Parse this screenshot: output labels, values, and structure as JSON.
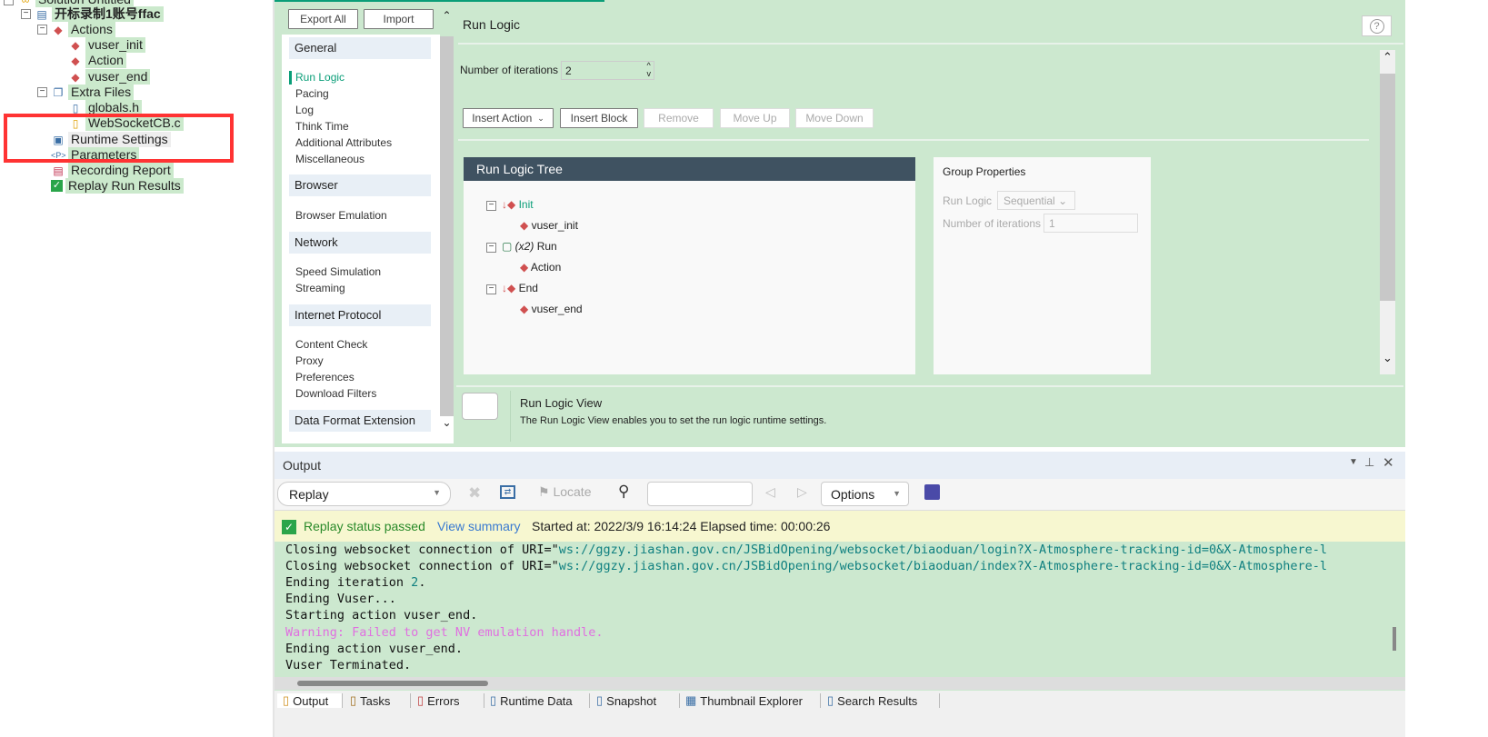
{
  "tree": {
    "solution": "Solution Untitled",
    "script": "开标录制1账号ffac",
    "actions": "Actions",
    "vuser_init": "vuser_init",
    "action": "Action",
    "vuser_end": "vuser_end",
    "extra_files": "Extra Files",
    "globals": "globals.h",
    "websocket": "WebSocketCB.c",
    "runtime_settings": "Runtime Settings",
    "parameters": "Parameters",
    "recording_report": "Recording Report",
    "replay_results": "Replay Run Results"
  },
  "nav": {
    "export_all": "Export All",
    "import": "Import",
    "sections": [
      {
        "title": "General",
        "items": [
          "Run Logic",
          "Pacing",
          "Log",
          "Think Time",
          "Additional Attributes",
          "Miscellaneous"
        ]
      },
      {
        "title": "Browser",
        "items": [
          "Browser Emulation"
        ]
      },
      {
        "title": "Network",
        "items": [
          "Speed Simulation",
          "Streaming"
        ]
      },
      {
        "title": "Internet Protocol",
        "items": [
          "Content Check",
          "Proxy",
          "Preferences",
          "Download Filters"
        ]
      },
      {
        "title": "Data Format Extension",
        "items": []
      }
    ],
    "active": "Run Logic"
  },
  "content": {
    "title": "Run Logic",
    "help": "?",
    "iterations_label": "Number of iterations",
    "iterations_value": "2",
    "insert_action": "Insert Action",
    "insert_block": "Insert Block",
    "remove": "Remove",
    "move_up": "Move Up",
    "move_down": "Move Down",
    "tree_title": "Run Logic Tree",
    "tree": {
      "init": "Init",
      "vuser_init": "vuser_init",
      "run_prefix": "(x2)",
      "run": "Run",
      "action": "Action",
      "end": "End",
      "vuser_end": "vuser_end"
    },
    "group_title": "Group Properties",
    "group_run_logic_label": "Run Logic",
    "group_run_logic_value": "Sequential",
    "group_iter_label": "Number of iterations",
    "group_iter_value": "1",
    "help_title": "Run Logic View",
    "help_text": "The Run Logic View enables you to set the run logic runtime settings."
  },
  "output": {
    "title": "Output",
    "source": "Replay",
    "locate": "Locate",
    "search_value": "",
    "options": "Options",
    "status": "Replay status passed",
    "view_summary": "View summary",
    "started": "Started at: 2022/3/9 16:14:24 Elapsed time: 00:00:26",
    "lines": [
      {
        "pre": "Closing websocket connection of URI=\"",
        "url": "ws://ggzy.jiashan.gov.cn/JSBidOpening/websocket/biaoduan/login?X-Atmosphere-tracking-id=0&X-Atmosphere-l"
      },
      {
        "pre": "Closing websocket connection of URI=\"",
        "url": "ws://ggzy.jiashan.gov.cn/JSBidOpening/websocket/biaoduan/index?X-Atmosphere-tracking-id=0&X-Atmosphere-l"
      }
    ],
    "iter_pre": "Ending iteration ",
    "iter_num": "2",
    "iter_post": ".",
    "plain": [
      "Ending Vuser...",
      "Starting action vuser_end."
    ],
    "warning": "Warning: Failed to get NV emulation handle.",
    "plain2": [
      "Ending action vuser_end.",
      "Vuser Terminated."
    ]
  },
  "tabs": [
    "Output",
    "Tasks",
    "Errors",
    "Runtime Data",
    "Snapshot",
    "Thumbnail Explorer",
    "Search Results"
  ],
  "colors": {
    "panel_green": "#cce8cf",
    "accent": "#0a9e78",
    "warning": "#e070e0",
    "highlight": "#ff3333"
  }
}
